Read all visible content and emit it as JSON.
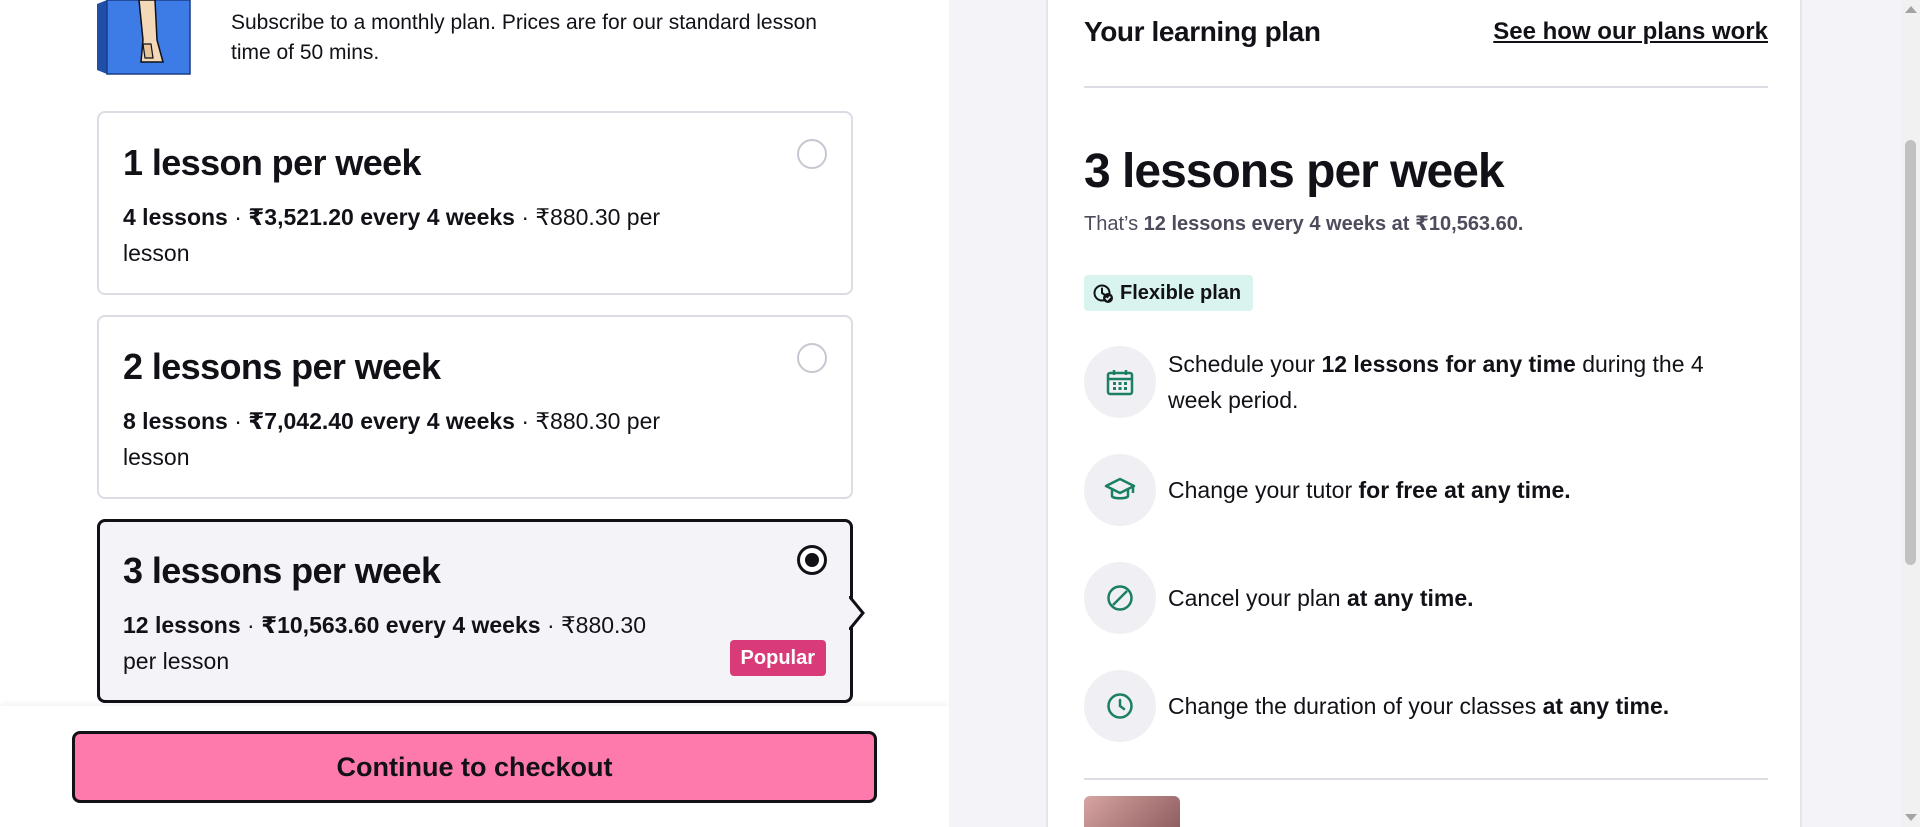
{
  "intro": {
    "text": "Subscribe to a monthly plan. Prices are for our standard lesson time of 50 mins.",
    "illustration_icon": "book-illustration-icon"
  },
  "plans": [
    {
      "title": "1 lesson per week",
      "lessons": "4 lessons",
      "sep1": " · ",
      "price": "₹3,521.20 every 4 weeks",
      "sep2": " · ",
      "per_lesson": "₹880.30 per lesson",
      "selected": false
    },
    {
      "title": "2 lessons per week",
      "lessons": "8 lessons",
      "sep1": " · ",
      "price": "₹7,042.40 every 4 weeks",
      "sep2": " · ",
      "per_lesson": "₹880.30 per lesson",
      "selected": false
    },
    {
      "title": "3 lessons per week",
      "lessons": "12 lessons",
      "sep1": " · ",
      "price": "₹10,563.60 every 4 weeks",
      "sep2": " · ",
      "per_lesson": "₹880.30 per lesson",
      "selected": true,
      "badge": "Popular"
    }
  ],
  "checkout": {
    "label": "Continue to checkout"
  },
  "panel": {
    "title": "Your learning plan",
    "link": "See how our plans work",
    "summary_title": "3 lessons per week",
    "summary_prefix": "That’s ",
    "summary_bold": "12 lessons every 4 weeks at ₹10,563.60.",
    "flex_badge": "Flexible plan",
    "features": [
      {
        "icon": "calendar-icon",
        "pre": "Schedule your ",
        "bold": "12 lessons for any time",
        "post": " during the 4 week period."
      },
      {
        "icon": "graduation-cap-icon",
        "pre": "Change your tutor ",
        "bold": "for free at any time.",
        "post": ""
      },
      {
        "icon": "cancel-icon",
        "pre": "Cancel your plan ",
        "bold": "at any time.",
        "post": ""
      },
      {
        "icon": "clock-icon",
        "pre": "Change the duration of your classes ",
        "bold": "at any time.",
        "post": ""
      }
    ]
  },
  "colors": {
    "accent_pink": "#ff7aac",
    "popular_badge": "#d93b78",
    "flex_badge_bg": "#d9f4ee",
    "icon_green": "#1a7f64",
    "text_dark": "#121117"
  }
}
